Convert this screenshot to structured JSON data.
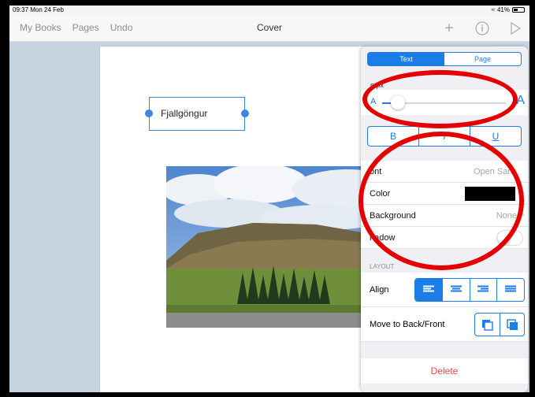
{
  "status_bar": {
    "time": "09:37  Mon 24 Feb",
    "battery": "41%",
    "battery_level": 0.41
  },
  "nav": {
    "my_books": "My Books",
    "pages": "Pages",
    "undo": "Undo",
    "title": "Cover"
  },
  "canvas": {
    "text_box_label": "Fjallgöngur"
  },
  "inspector": {
    "tabs": {
      "text": "Text",
      "page": "Page"
    },
    "size_label": "o px",
    "slider": {
      "min_glyph": "A",
      "max_glyph": "A",
      "level": 0.13
    },
    "style": {
      "bold": "B",
      "italic": "I",
      "underline": "U"
    },
    "rows": {
      "font_label": "ont",
      "font_value": "Open Sans",
      "color_label": "Color",
      "background_label": "Background",
      "background_value": "None",
      "shadow_label": "hadow"
    },
    "layout_section": "LAYOUT",
    "align_label": "Align",
    "move_label": "Move to Back/Front",
    "delete_label": "Delete"
  },
  "colors": {
    "accent": "#1a7de8",
    "annotation": "#e40000",
    "text_color_swatch": "#000000",
    "delete": "#e34a45"
  }
}
